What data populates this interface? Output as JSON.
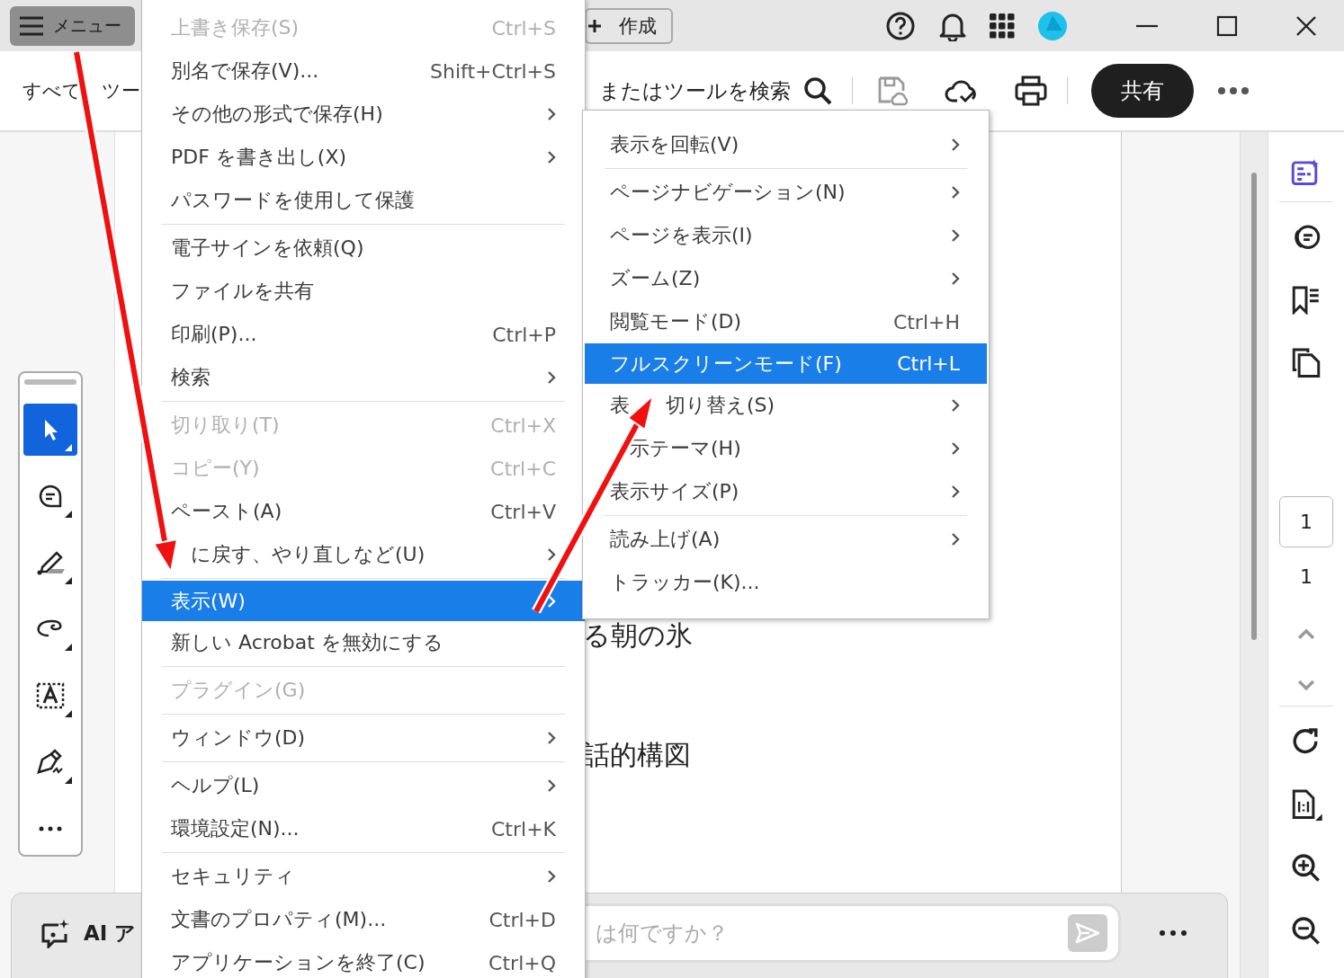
{
  "title_bar": {
    "menu_button": "メニュー",
    "create_button": "作成"
  },
  "toolbar": {
    "tools_label": "すべて",
    "tools_label_rest": "ツー",
    "search_text": "またはツールを検索",
    "share_button": "共有"
  },
  "tool_palette": [
    {
      "kind": "select",
      "selected": true
    },
    {
      "kind": "comment",
      "selected": false
    },
    {
      "kind": "highlight",
      "selected": false
    },
    {
      "kind": "lasso",
      "selected": false
    },
    {
      "kind": "text",
      "selected": false
    },
    {
      "kind": "sign",
      "selected": false
    },
    {
      "kind": "more",
      "selected": false
    }
  ],
  "document": {
    "lines": [
      "る朝の氷",
      "話的構図"
    ]
  },
  "page_nav": {
    "current": "1",
    "total": "1"
  },
  "ai_bar": {
    "label": "AI ア",
    "placeholder": "は何ですか？"
  },
  "main_menu": [
    [
      {
        "label": "上書き保存(S)",
        "shortcut": "Ctrl+S",
        "submenu": false,
        "disabled": true,
        "selected": false
      },
      {
        "label": "別名で保存(V)...",
        "shortcut": "Shift+Ctrl+S",
        "submenu": false,
        "disabled": false,
        "selected": false
      },
      {
        "label": "その他の形式で保存(H)",
        "submenu": true,
        "disabled": false,
        "selected": false
      },
      {
        "label": "PDF を書き出し(X)",
        "submenu": true,
        "disabled": false,
        "selected": false
      },
      {
        "label": "パスワードを使用して保護",
        "submenu": false,
        "disabled": false,
        "selected": false
      }
    ],
    [
      {
        "label": "電子サインを依頼(Q)",
        "submenu": false,
        "disabled": false,
        "selected": false
      },
      {
        "label": "ファイルを共有",
        "submenu": false,
        "disabled": false,
        "selected": false
      },
      {
        "label": "印刷(P)...",
        "shortcut": "Ctrl+P",
        "submenu": false,
        "disabled": false,
        "selected": false
      },
      {
        "label": "検索",
        "submenu": true,
        "disabled": false,
        "selected": false
      }
    ],
    [
      {
        "label": "切り取り(T)",
        "shortcut": "Ctrl+X",
        "submenu": false,
        "disabled": true,
        "selected": false
      },
      {
        "label": "コピー(Y)",
        "shortcut": "Ctrl+C",
        "submenu": false,
        "disabled": true,
        "selected": false
      },
      {
        "label": "ペースト(A)",
        "shortcut": "Ctrl+V",
        "submenu": false,
        "disabled": false,
        "selected": false
      },
      {
        "label": "に戻す、やり直しなど(U)",
        "kind": "covered",
        "submenu": true,
        "disabled": false,
        "selected": false
      }
    ],
    [
      {
        "label": "表示(W)",
        "submenu": true,
        "disabled": false,
        "selected": true
      },
      {
        "label": "新しい Acrobat を無効にする",
        "submenu": false,
        "disabled": false,
        "selected": false
      }
    ],
    [
      {
        "label": "プラグイン(G)",
        "submenu": false,
        "disabled": true,
        "selected": false
      }
    ],
    [
      {
        "label": "ウィンドウ(D)",
        "submenu": true,
        "disabled": false,
        "selected": false
      }
    ],
    [
      {
        "label": "ヘルプ(L)",
        "submenu": true,
        "disabled": false,
        "selected": false
      },
      {
        "label": "環境設定(N)...",
        "shortcut": "Ctrl+K",
        "submenu": false,
        "disabled": false,
        "selected": false
      }
    ],
    [
      {
        "label": "セキュリティ",
        "submenu": true,
        "disabled": false,
        "selected": false
      },
      {
        "label": "文書のプロパティ(M)...",
        "shortcut": "Ctrl+D",
        "submenu": false,
        "disabled": false,
        "selected": false
      },
      {
        "label": "アプリケーションを終了(C)",
        "shortcut": "Ctrl+Q",
        "submenu": false,
        "disabled": false,
        "selected": false
      }
    ]
  ],
  "view_submenu": [
    [
      {
        "label": "表示を回転(V)",
        "submenu": true,
        "disabled": false,
        "selected": false
      }
    ],
    [
      {
        "label": "ページナビゲーション(N)",
        "submenu": true,
        "disabled": false,
        "selected": false
      },
      {
        "label": "ページを表示(I)",
        "submenu": true,
        "disabled": false,
        "selected": false
      },
      {
        "label": "ズーム(Z)",
        "submenu": true,
        "disabled": false,
        "selected": false
      },
      {
        "label": "閲覧モード(D)",
        "shortcut": "Ctrl+H",
        "submenu": false,
        "disabled": false,
        "selected": false
      },
      {
        "label": "フルスクリーンモード(F)",
        "shortcut": "Ctrl+L",
        "submenu": false,
        "disabled": false,
        "selected": true
      },
      {
        "lead": "表",
        "label": "切り替え(S)",
        "kind": "covered",
        "submenu": true,
        "disabled": false,
        "selected": false
      },
      {
        "label": "示テーマ(H)",
        "kind": "covered",
        "submenu": true,
        "disabled": false,
        "selected": false
      },
      {
        "label": "表示サイズ(P)",
        "submenu": true,
        "disabled": false,
        "selected": false
      }
    ],
    [
      {
        "label": "読み上げ(A)",
        "submenu": true,
        "disabled": false,
        "selected": false
      },
      {
        "label": "トラッカー(K)...",
        "submenu": false,
        "disabled": false,
        "selected": false
      }
    ]
  ]
}
